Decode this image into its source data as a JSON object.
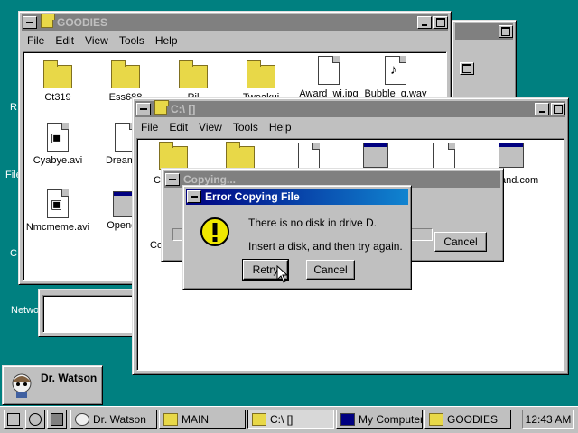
{
  "desktop": {
    "icons": [
      "R",
      "File",
      "C",
      "Netwo"
    ]
  },
  "goodies_window": {
    "title": "GOODIES",
    "menu": [
      "File",
      "Edit",
      "View",
      "Tools",
      "Help"
    ],
    "files": [
      {
        "label": "Ct319",
        "icon": "folder-icon"
      },
      {
        "label": "Ess688",
        "icon": "folder-icon"
      },
      {
        "label": "Ril",
        "icon": "folder-icon"
      },
      {
        "label": "Tweakui",
        "icon": "folder-icon"
      },
      {
        "label": "Award_wi.jpg",
        "icon": "image-file-icon"
      },
      {
        "label": "Bubble_g.wav",
        "icon": "audio-file-icon"
      },
      {
        "label": "Cyabye.avi",
        "icon": "video-file-icon"
      },
      {
        "label": "Dreamfis",
        "icon": "document-icon"
      },
      {
        "label": "Nmcmeme.avi",
        "icon": "video-file-icon"
      },
      {
        "label": "Opengl1",
        "icon": "application-icon"
      }
    ]
  },
  "c_window": {
    "title": "C:\\ []",
    "menu": [
      "File",
      "Edit",
      "View",
      "Tools",
      "Help"
    ],
    "partial_label_left": "C",
    "partial_label_co": "Co",
    "partial_label_right": "and.com"
  },
  "copying_dialog": {
    "title": "Copying...",
    "cancel_label": "Cancel"
  },
  "error_dialog": {
    "title": "Error Copying File",
    "line1": "There is no disk in drive D.",
    "line2": "Insert a disk, and then try again.",
    "retry_label": "Retry",
    "cancel_label": "Cancel"
  },
  "drwatson_panel": {
    "label": "Dr. Watson"
  },
  "taskbar": {
    "items": [
      {
        "label": "Dr. Watson",
        "icon": "drwatson-icon",
        "pressed": false
      },
      {
        "label": "MAIN",
        "icon": "folder-icon",
        "pressed": false
      },
      {
        "label": "C:\\ []",
        "icon": "folder-icon",
        "pressed": true
      },
      {
        "label": "My Computer",
        "icon": "computer-icon",
        "pressed": false
      },
      {
        "label": "GOODIES",
        "icon": "folder-icon",
        "pressed": false
      }
    ],
    "clock": "12:43 AM"
  },
  "colors": {
    "desktop": "#008080",
    "active_title": "#000080",
    "inactive_title": "#808080",
    "folder": "#e8d848"
  }
}
